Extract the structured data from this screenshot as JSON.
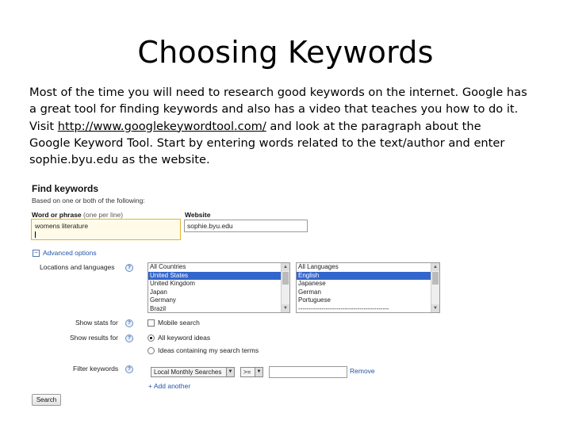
{
  "slide": {
    "title": "Choosing Keywords",
    "body_line1": "Most of the time you will need to research good keywords on the internet. Google has",
    "body_line2": "a great tool for finding keywords and also has a video that teaches you how to do it.",
    "body_line3_prefix": "Visit ",
    "body_link": "http://www.googlekeywordtool.com/",
    "body_line3_suffix": " and look at the paragraph about the",
    "body_line4": "Google Keyword Tool.  Start by entering words related to the text/author and enter",
    "body_line5": "sophie.byu.edu as the website."
  },
  "form": {
    "title": "Find keywords",
    "subtitle": "Based on one or both of the following:",
    "phrase_label": "Word or phrase",
    "phrase_hint": " (one per line)",
    "phrase_value": "womens literature",
    "website_label": "Website",
    "website_value": "sophie.byu.edu",
    "advanced_options": "Advanced options",
    "locations_label": "Locations and languages",
    "help_glyph": "?",
    "countries": [
      "All Countries",
      "United States",
      "United Kingdom",
      "Japan",
      "Germany",
      "Brazil"
    ],
    "languages": [
      "All Languages",
      "English",
      "Japanese",
      "German",
      "Portuguese",
      "-------------------------------------------"
    ],
    "show_stats_label": "Show stats for",
    "mobile_search": "Mobile search",
    "show_results_label": "Show results for",
    "all_keyword_ideas": "All keyword ideas",
    "ideas_containing": "Ideas containing my search terms",
    "filter_label": "Filter keywords",
    "filter_metric": "Local Monthly Searches",
    "filter_operator": ">=",
    "remove": "Remove",
    "add_another": "+ Add another",
    "search_button": "Search"
  },
  "colors": {
    "link": "#2255aa",
    "selected": "#3366cc",
    "phrase_border": "#e2b233"
  }
}
